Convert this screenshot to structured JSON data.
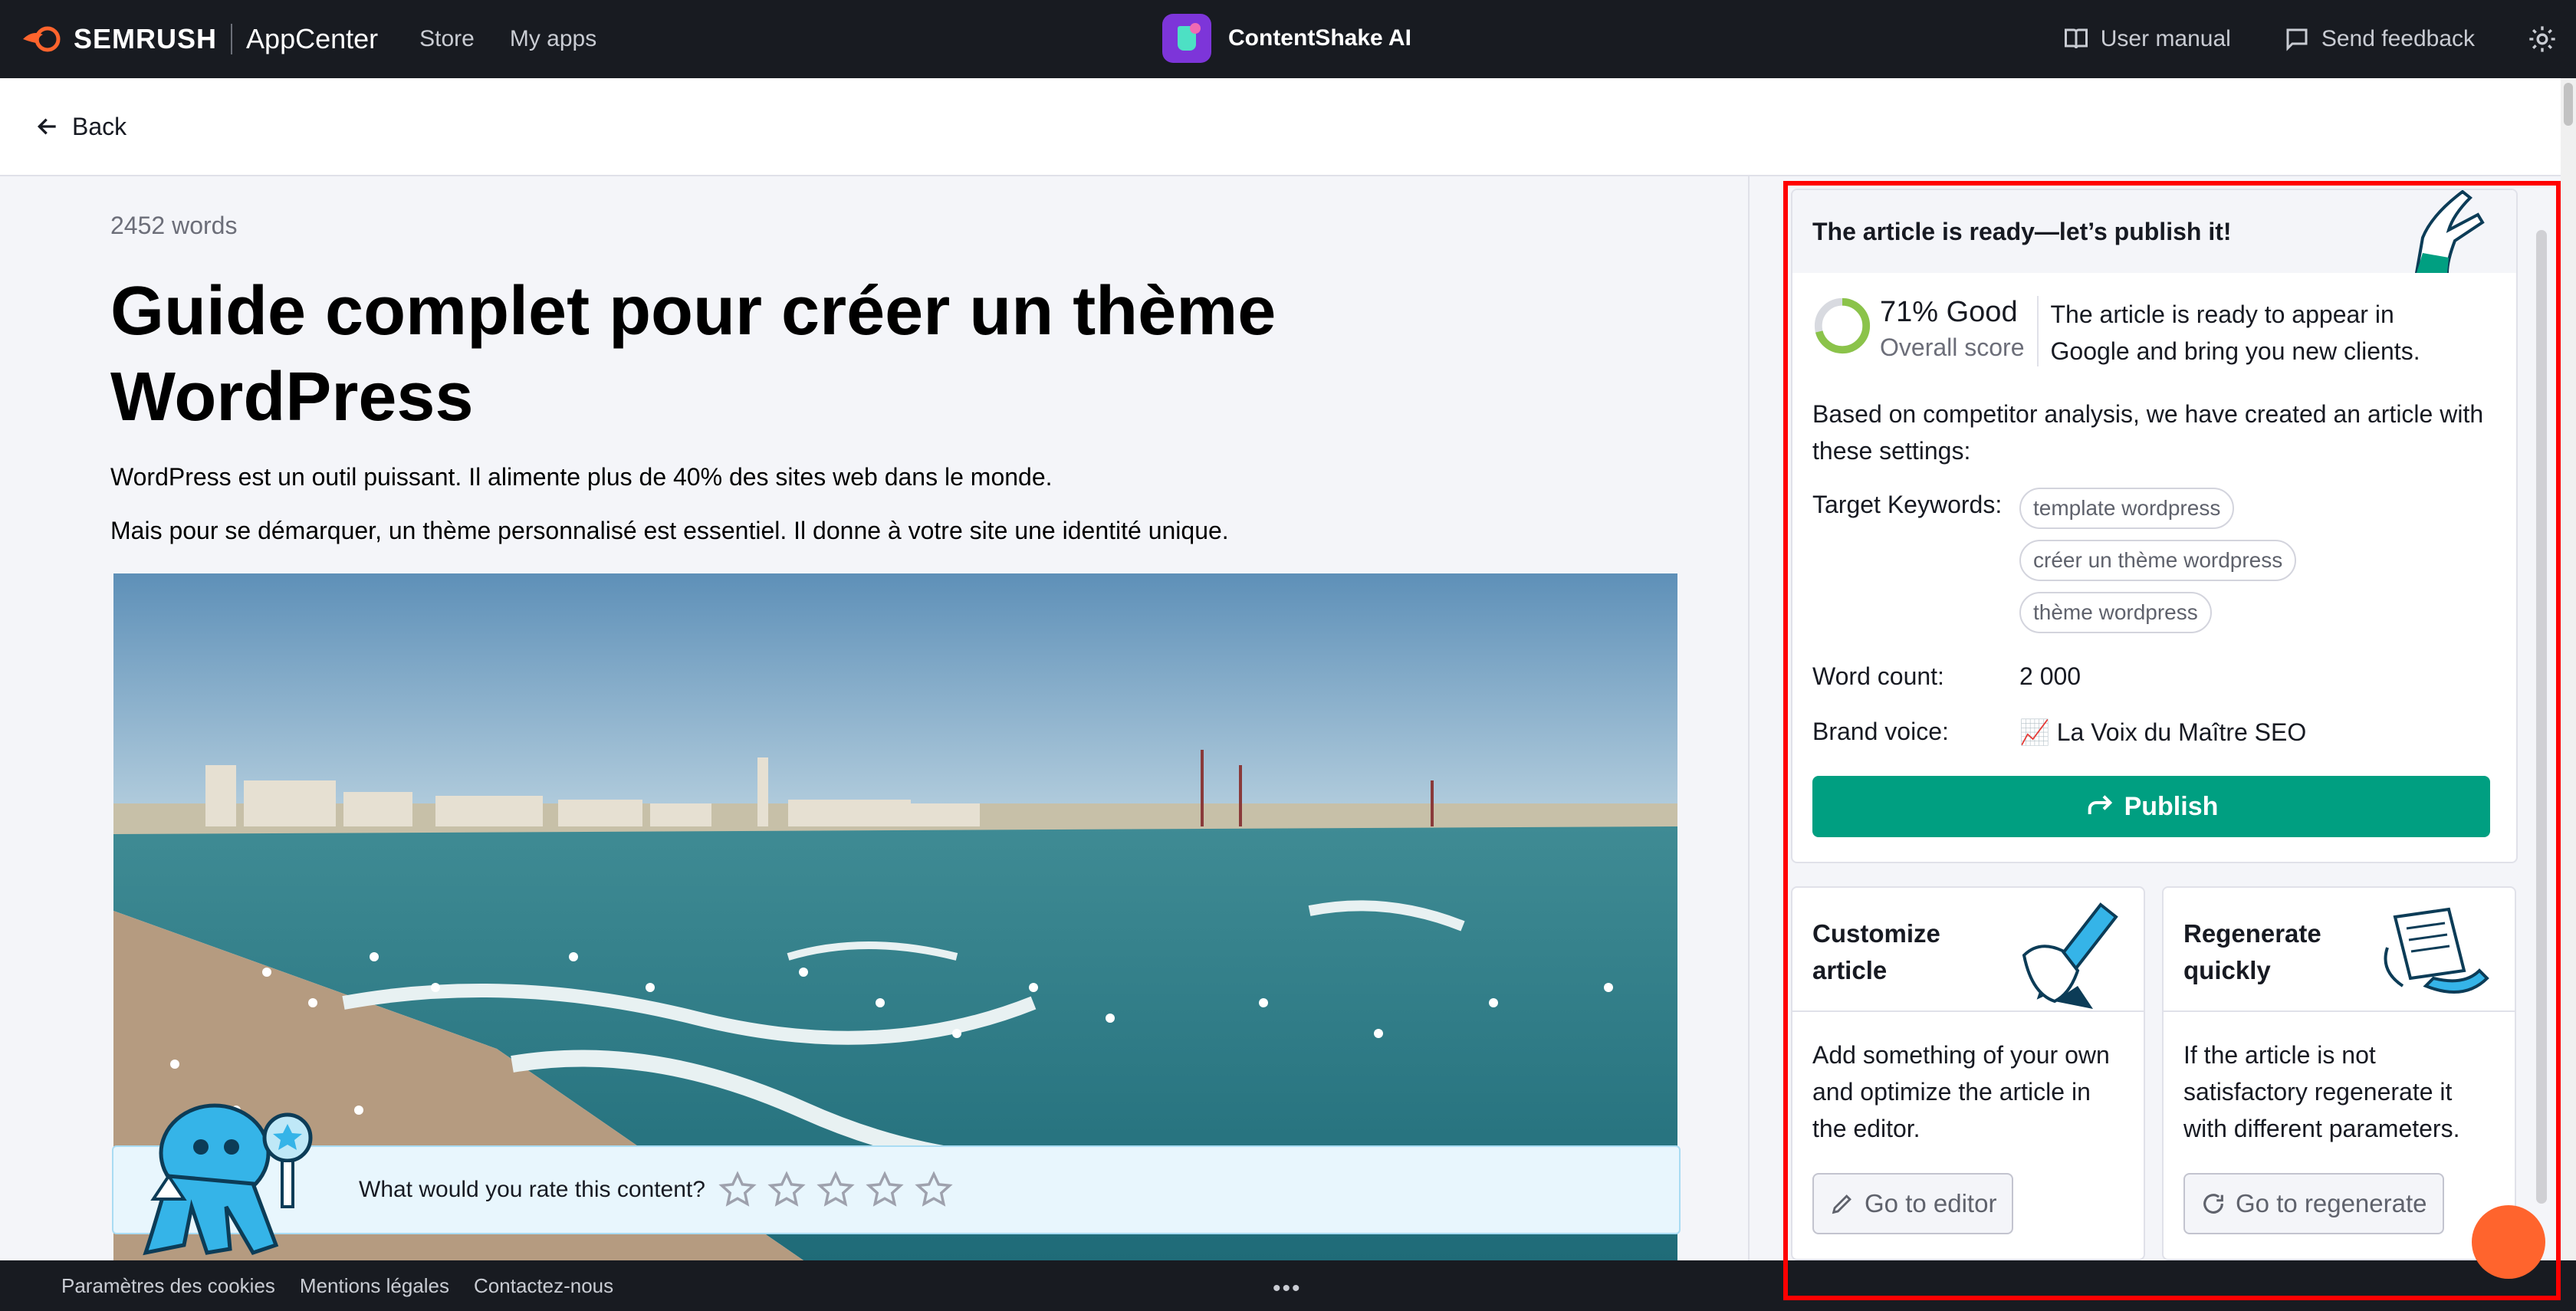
{
  "topnav": {
    "brand": "SEMRUSH",
    "app_center": "AppCenter",
    "links": [
      "Store",
      "My apps"
    ],
    "app_title": "ContentShake AI",
    "user_manual": "User manual",
    "send_feedback": "Send feedback"
  },
  "back_label": "Back",
  "article": {
    "word_count": "2452 words",
    "title": "Guide complet pour créer un thème WordPress",
    "para1": "WordPress est un outil puissant. Il alimente plus de 40% des sites web dans le monde.",
    "para2": "Mais pour se démarquer, un thème personnalisé est essentiel. Il donne à votre site une identité unique."
  },
  "rating": {
    "prompt": "What would you rate this content?",
    "max_stars": 5,
    "selected": 0
  },
  "panel": {
    "title": "The article is ready—let’s publish it!",
    "score_value": "71% Good",
    "score_percent": 71,
    "score_label": "Overall score",
    "score_desc": "The article is ready to appear in Google and bring you new clients.",
    "based_on": "Based on competitor analysis, we have created an article with these settings:",
    "keywords_label": "Target Keywords:",
    "keywords": [
      "template wordpress",
      "créer un thème wordpress",
      "thème wordpress"
    ],
    "word_count_label": "Word count:",
    "word_count_value": "2 000",
    "brand_voice_label": "Brand voice:",
    "brand_voice_value": "📈 La Voix du Maître SEO",
    "publish_label": "Publish"
  },
  "cards": {
    "customize": {
      "title": "Customize article",
      "body": "Add something of your own and optimize the article in the editor.",
      "button": "Go to editor"
    },
    "regenerate": {
      "title": "Regenerate quickly",
      "body": "If the article is not satisfactory regenerate it with different parameters.",
      "button": "Go to regenerate"
    }
  },
  "footer": {
    "links": [
      "Paramètres des cookies",
      "Mentions légales",
      "Contactez-nous"
    ],
    "more": "•••"
  },
  "colors": {
    "nav_bg": "#181b21",
    "publish_green": "#009f81",
    "score_green": "#8bc34a",
    "highlight_red": "#ff0000",
    "chat_orange": "#ff642d"
  }
}
